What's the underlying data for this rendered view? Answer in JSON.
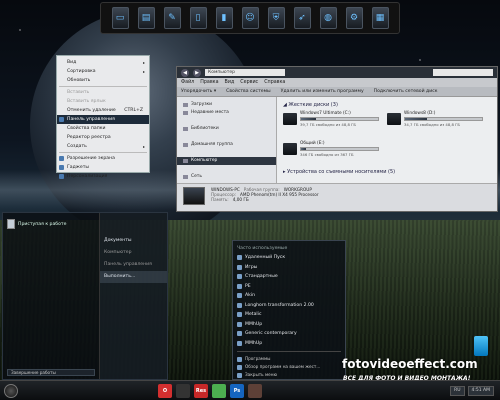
{
  "dock": {
    "icons": [
      "monitor-icon",
      "window-icon",
      "text-editor-icon",
      "terminal-icon",
      "tablet-icon",
      "person-icon",
      "shield-icon",
      "bird-icon",
      "globe-icon",
      "gear-icon",
      "grid-icon"
    ]
  },
  "context_menu": {
    "items": [
      {
        "label": "Вид",
        "arrow": "▸",
        "state": "normal"
      },
      {
        "label": "Сортировка",
        "arrow": "▸",
        "state": "normal"
      },
      {
        "label": "Обновить",
        "state": "normal"
      },
      {
        "sep": true
      },
      {
        "label": "Вставить",
        "state": "disabled"
      },
      {
        "label": "Вставить ярлык",
        "state": "disabled"
      },
      {
        "label": "Отменить удаление",
        "shortcut": "CTRL+Z",
        "state": "normal"
      },
      {
        "label": "Панель управления",
        "state": "active"
      },
      {
        "label": "Свойства папки",
        "state": "normal"
      },
      {
        "label": "Редактор реестра",
        "state": "normal"
      },
      {
        "label": "Создать",
        "arrow": "▸",
        "state": "normal"
      },
      {
        "sep": true
      },
      {
        "label": "Разрешение экрана",
        "state": "normal"
      },
      {
        "label": "Гаджеты",
        "state": "normal"
      },
      {
        "label": "Персонализация",
        "state": "normal"
      }
    ]
  },
  "explorer": {
    "address": "Компьютер",
    "menu": [
      "Файл",
      "Правка",
      "Вид",
      "Сервис",
      "Справка"
    ],
    "toolbar": [
      "Упорядочить ▾",
      "Свойства системы",
      "Удалить или изменить программу",
      "Подключить сетевой диск"
    ],
    "nav": [
      {
        "label": "Загрузки"
      },
      {
        "label": "Недавние места"
      },
      {
        "label": ""
      },
      {
        "label": "Библиотеки"
      },
      {
        "label": ""
      },
      {
        "label": "Домашняя группа"
      },
      {
        "label": ""
      },
      {
        "label": "Компьютер",
        "selected": true
      },
      {
        "label": ""
      },
      {
        "label": "Сеть"
      }
    ],
    "group_hdd": "◢ Жесткие диски (3)",
    "drives": [
      {
        "name": "Windows7 Ultimate (C:)",
        "free": "39,7 ГБ свободно из 48,8 ГБ",
        "used": 0.19
      },
      {
        "name": "Windows8 (D:)",
        "free": "34,7 ГБ свободно из 48,8 ГБ",
        "used": 0.29
      },
      {
        "name": "Общий (E:)",
        "free": "346 ГБ свободно из 367 ГБ",
        "used": 0.06
      }
    ],
    "group_removable": "▸ Устройства со съемными носителями (5)",
    "details": {
      "name": "WINDOWS-PC",
      "workgroup_label": "Рабочая группа:",
      "workgroup": "WORKGROUP",
      "cpu_label": "Процессор:",
      "cpu": "AMD Phenom(tm) II X4 955 Processor",
      "ram_label": "Память:",
      "ram": "4,00 ГБ"
    }
  },
  "start_panel": {
    "pinned": "Приступая к работе",
    "right_items": [
      {
        "label": "Документы",
        "state": "normal"
      },
      {
        "label": "Компьютер",
        "state": "dim"
      },
      {
        "label": "Панель управления",
        "state": "dim"
      },
      {
        "label": "Выполнить...",
        "state": "hl"
      }
    ],
    "shutdown": "Завершение работы"
  },
  "programs": {
    "header": "Часто используемые",
    "items": [
      "Удаленный Пуск",
      "Игры",
      "Стандартные",
      "PE",
      "Akin",
      "Longhorn transformation 2.00",
      "Metalic",
      "MMhUp",
      "Generic contemporary",
      "MMhUp"
    ],
    "footer": [
      "Программы",
      "Обзор программ на вашем жест...",
      "Закрыть меню"
    ]
  },
  "taskbar": {
    "apps": [
      {
        "label": "O",
        "color": "#d32f2f"
      },
      {
        "label": "",
        "color": "#333333"
      },
      {
        "label": "Res",
        "color": "#c62828"
      },
      {
        "label": "",
        "color": "#4caf50"
      },
      {
        "label": "Ps",
        "color": "#1565c0"
      },
      {
        "label": "",
        "color": "#5d4037"
      }
    ],
    "tray": [
      "RU",
      "4:51 AM"
    ]
  },
  "watermark": {
    "site": "fotovideoeffect.com",
    "slogan": "ВСЕ ДЛЯ ФОТО И ВИДЕО МОНТАЖА!"
  }
}
